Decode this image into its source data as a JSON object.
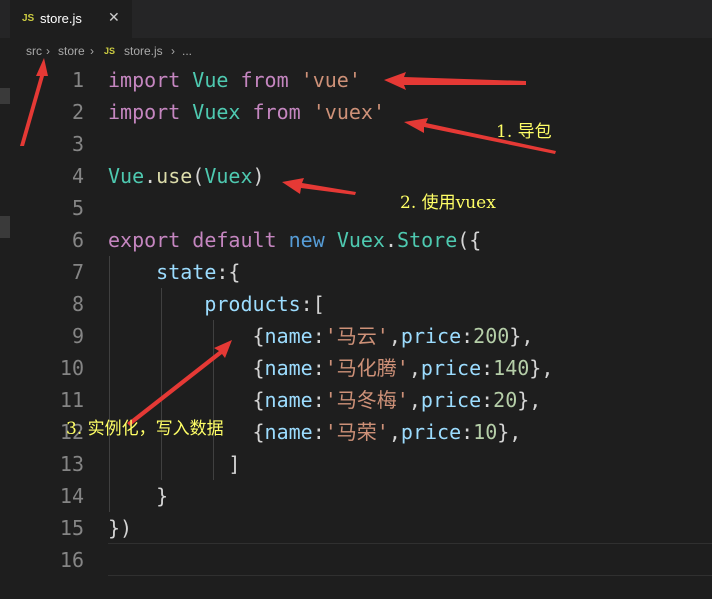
{
  "tab": {
    "lang_badge": "JS",
    "filename": "store.js",
    "close": "✕"
  },
  "breadcrumb": {
    "items": [
      "src",
      "store",
      "store.js",
      "..."
    ],
    "separator": "›",
    "lang_badge": "JS"
  },
  "line_numbers": [
    "1",
    "2",
    "3",
    "4",
    "5",
    "6",
    "7",
    "8",
    "9",
    "10",
    "11",
    "12",
    "13",
    "14",
    "15",
    "16"
  ],
  "code": {
    "l1": [
      "import",
      "Vue",
      "from",
      "'vue'"
    ],
    "l2": [
      "import",
      "Vuex",
      "from",
      "'vuex'"
    ],
    "l4": [
      "Vue",
      ".",
      "use",
      "(",
      "Vuex",
      ")"
    ],
    "l6": [
      "export",
      "default",
      "new",
      "Vuex",
      ".",
      "Store",
      "({"
    ],
    "l7": [
      "state",
      ":{"
    ],
    "l8": [
      "products",
      ":["
    ],
    "products": [
      {
        "key1": "{",
        "name_key": "name",
        "colon1": ":",
        "name_val": "'马云'",
        "comma": ",",
        "price_key": "price",
        "colon2": ":",
        "price_val": "200",
        "end": "},"
      },
      {
        "key1": "{",
        "name_key": "name",
        "colon1": ":",
        "name_val": "'马化腾'",
        "comma": ",",
        "price_key": "price",
        "colon2": ":",
        "price_val": "140",
        "end": "},"
      },
      {
        "key1": "{",
        "name_key": "name",
        "colon1": ":",
        "name_val": "'马冬梅'",
        "comma": ",",
        "price_key": "price",
        "colon2": ":",
        "price_val": "20",
        "end": "},"
      },
      {
        "key1": "{",
        "name_key": "name",
        "colon1": ":",
        "name_val": "'马荣'",
        "comma": ",",
        "price_key": "price",
        "colon2": ":",
        "price_val": "10",
        "end": "},"
      }
    ],
    "l13": "]",
    "l14": "}",
    "l15": "})"
  },
  "annotations": {
    "note1": "1. 导包",
    "note2": "2. 使用vuex",
    "note3": "3. 实例化，写入数据"
  },
  "colors": {
    "arrow": "#e53935",
    "note_text": "#ffff66"
  }
}
